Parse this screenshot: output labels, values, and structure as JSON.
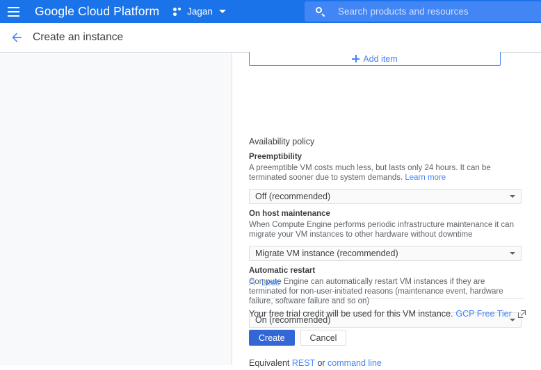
{
  "topbar": {
    "menu_icon": "hamburger-menu-icon",
    "brand": "Google Cloud Platform",
    "project_icon": "project-dots-icon",
    "project_name": "Jagan",
    "project_caret_icon": "caret-down-icon",
    "search": {
      "icon": "search-icon",
      "placeholder": "Search products and resources",
      "value": ""
    }
  },
  "subheader": {
    "back_icon": "arrow-left-icon",
    "title": "Create an instance"
  },
  "main": {
    "add_item": {
      "icon": "plus-icon",
      "label": "Add item"
    },
    "section_title": "Availability policy",
    "fields": [
      {
        "label": "Preemptibility",
        "desc_part1": "A preemptible VM costs much less, but lasts only 24 hours. It can be terminated sooner due to system demands. ",
        "desc_link": "Learn more",
        "value": "Off (recommended)",
        "arrow_icon": "caret-down-icon"
      },
      {
        "label": "On host maintenance",
        "desc_part1": "When Compute Engine performs periodic infrastructure maintenance it can migrate your VM instances to other hardware without downtime",
        "desc_link": "",
        "value": "Migrate VM instance (recommended)",
        "arrow_icon": "caret-down-icon"
      },
      {
        "label": "Automatic restart",
        "desc_part1": "Compute Engine can automatically restart VM instances if they are terminated for non-user-initiated reasons (maintenance event, hardware failure, software failure and so on)",
        "desc_link": "",
        "value": "On (recommended)",
        "arrow_icon": "caret-down-icon"
      }
    ],
    "less_toggle": {
      "icon": "chevron-up-double-icon",
      "label": "Less"
    },
    "trial_notice": {
      "text": "Your free trial credit will be used for this VM instance.",
      "link": "GCP Free Tier",
      "link_icon": "external-link-icon"
    },
    "actions": {
      "create_label": "Create",
      "cancel_label": "Cancel"
    },
    "equivalent": {
      "prefix": "Equivalent ",
      "rest_link": "REST",
      "separator": " or ",
      "cmdline_link": "command line"
    }
  },
  "colors": {
    "brand_blue": "#1a73e8",
    "search_blue": "#4285f4",
    "link_blue": "#4285f4",
    "primary_button": "#3367d6",
    "panel_gray": "#f8f9fa",
    "border_gray": "#dadce0",
    "text_primary": "#3c4043",
    "text_secondary": "#5f6368"
  }
}
